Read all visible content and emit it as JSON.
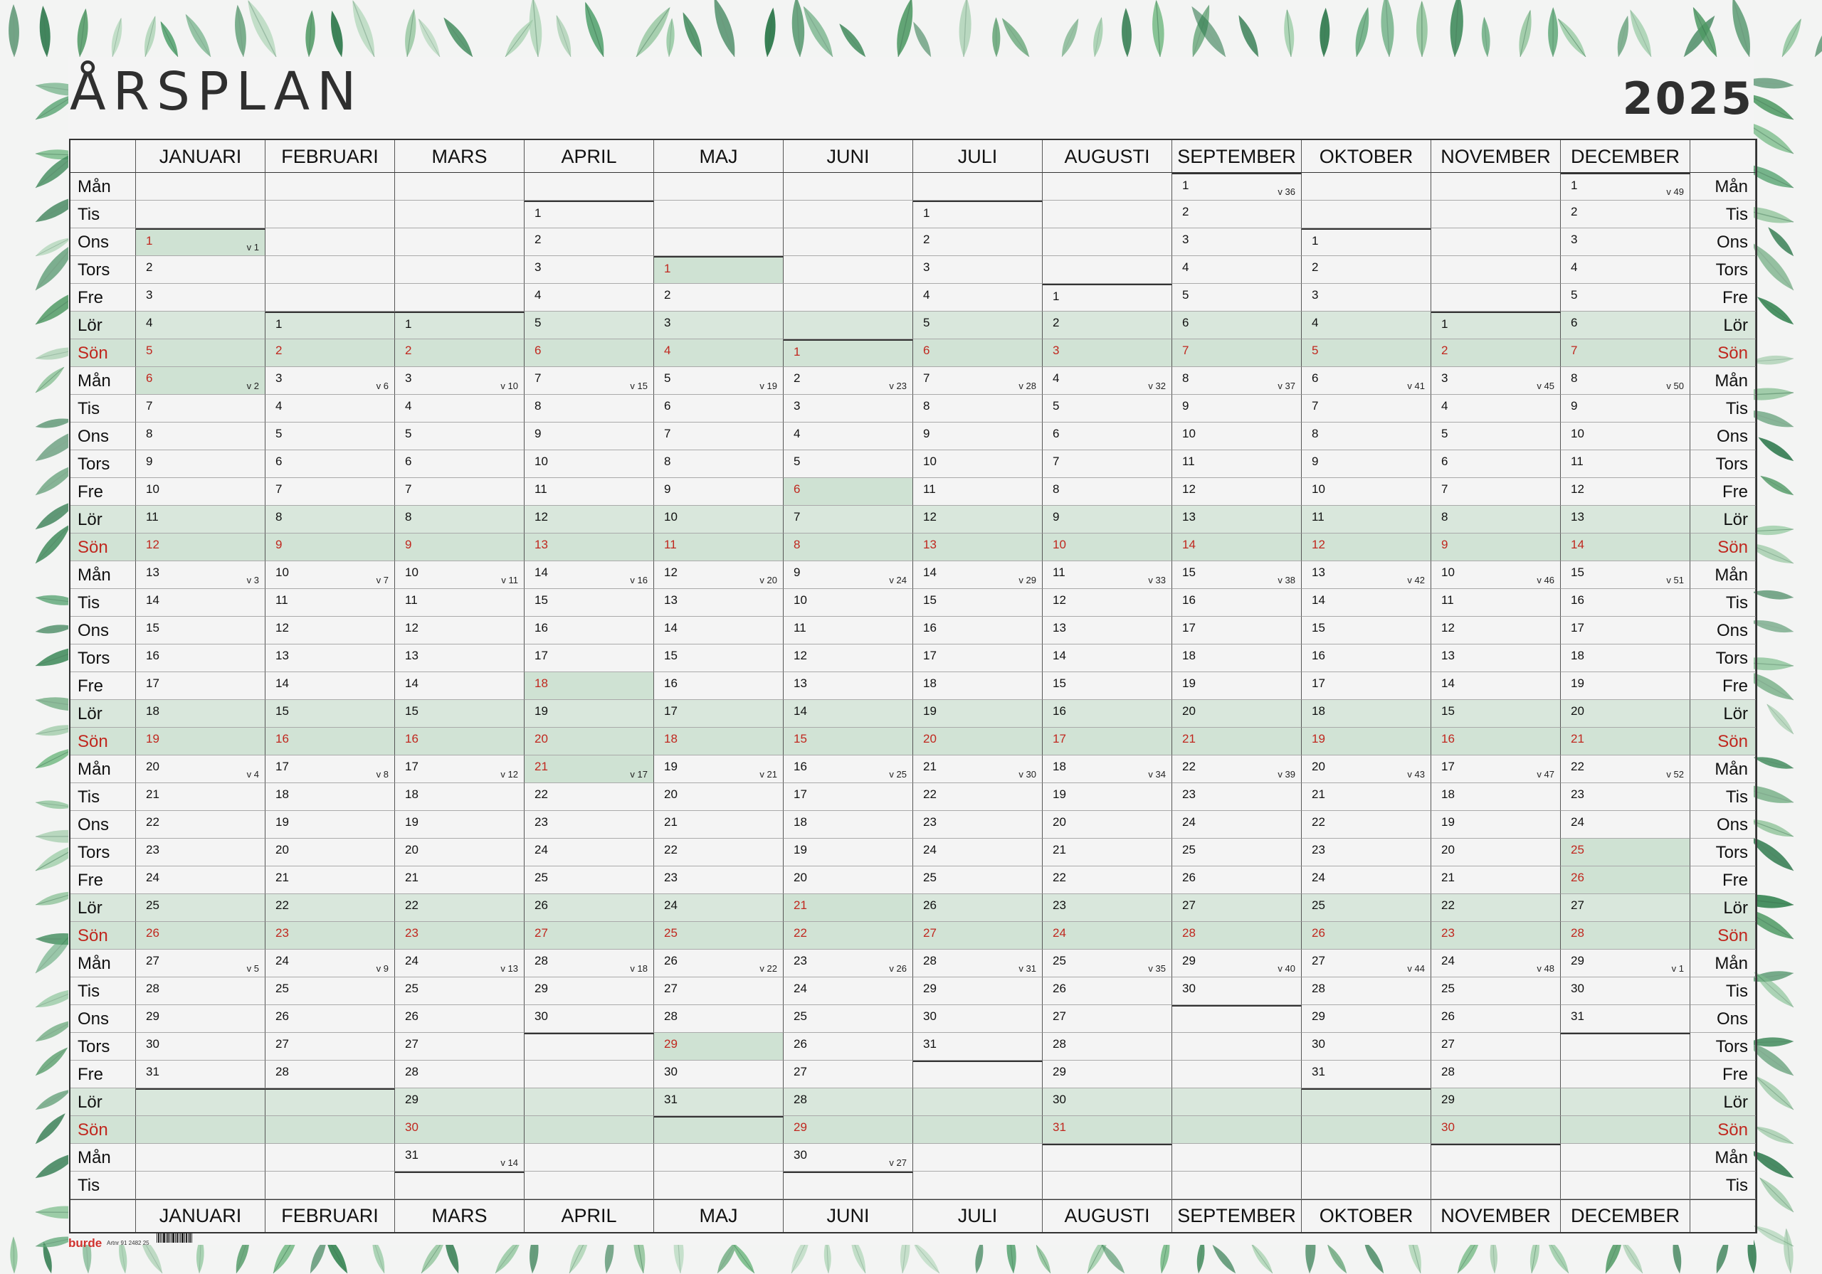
{
  "title": "ÅRSPLAN",
  "year": "2025",
  "months": [
    "JANUARI",
    "FEBRUARI",
    "MARS",
    "APRIL",
    "MAJ",
    "JUNI",
    "JULI",
    "AUGUSTI",
    "SEPTEMBER",
    "OKTOBER",
    "NOVEMBER",
    "DECEMBER"
  ],
  "weekdays": [
    "Mån",
    "Tis",
    "Ons",
    "Tors",
    "Fre",
    "Lör",
    "Sön"
  ],
  "month_days": [
    31,
    28,
    31,
    30,
    31,
    30,
    31,
    31,
    30,
    31,
    30,
    31
  ],
  "month_start_weekday": [
    2,
    5,
    5,
    1,
    3,
    6,
    1,
    4,
    0,
    2,
    5,
    0
  ],
  "holidays": {
    "JANUARI": [
      1,
      6
    ],
    "APRIL": [
      18,
      21
    ],
    "MAJ": [
      1,
      29
    ],
    "JUNI": [
      6,
      21
    ],
    "DECEMBER": [
      25,
      26
    ]
  },
  "footer": {
    "brand": "burde",
    "code": "Artnr 91 2482 25"
  },
  "colors": {
    "sunday_text": "#c0271e",
    "weekend_fill": "#d9e7dc",
    "holiday_fill": "#cfe2d3"
  }
}
